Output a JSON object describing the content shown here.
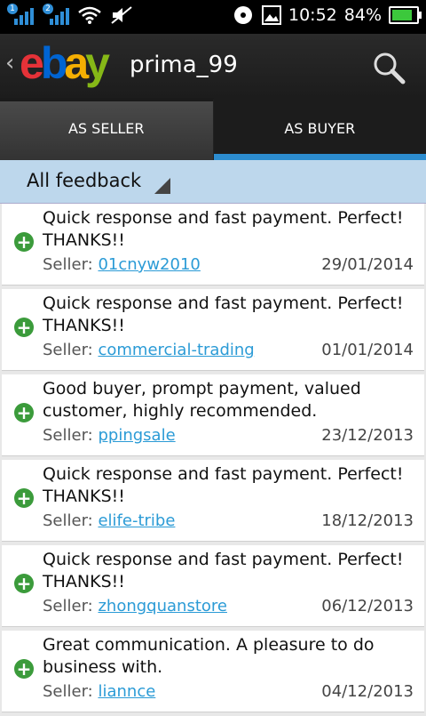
{
  "status_bar": {
    "sim1_badge": "1",
    "sim2_badge": "2",
    "time": "10:52",
    "battery_text": "84%",
    "battery_level": 0.84,
    "accent_color": "#2f8fd8"
  },
  "action_bar": {
    "back_icon": "chevron-left-icon",
    "logo": [
      "e",
      "b",
      "a",
      "y"
    ],
    "username": "prima_99",
    "search_icon": "search-icon"
  },
  "tabs": [
    {
      "label": "AS SELLER"
    },
    {
      "label": "AS BUYER"
    }
  ],
  "filter": {
    "label": "All feedback"
  },
  "feedback": [
    {
      "comment": "Quick response and fast payment. Perfect! THANKS!!",
      "seller_label": "Seller:",
      "seller": "01cnyw2010",
      "date": "29/01/2014"
    },
    {
      "comment": "Quick response and fast payment. Perfect! THANKS!!",
      "seller_label": "Seller:",
      "seller": "commercial-trading",
      "date": "01/01/2014"
    },
    {
      "comment": "Good buyer, prompt payment, valued customer, highly recommended.",
      "seller_label": "Seller:",
      "seller": "ppingsale",
      "date": "23/12/2013"
    },
    {
      "comment": "Quick response and fast payment. Perfect! THANKS!!",
      "seller_label": "Seller:",
      "seller": "elife-tribe",
      "date": "18/12/2013"
    },
    {
      "comment": "Quick response and fast payment. Perfect! THANKS!!",
      "seller_label": "Seller:",
      "seller": "zhongquanstore",
      "date": "06/12/2013"
    },
    {
      "comment": "Great communication. A pleasure to do business with.",
      "seller_label": "Seller:",
      "seller": "liannce",
      "date": "04/12/2013"
    }
  ]
}
